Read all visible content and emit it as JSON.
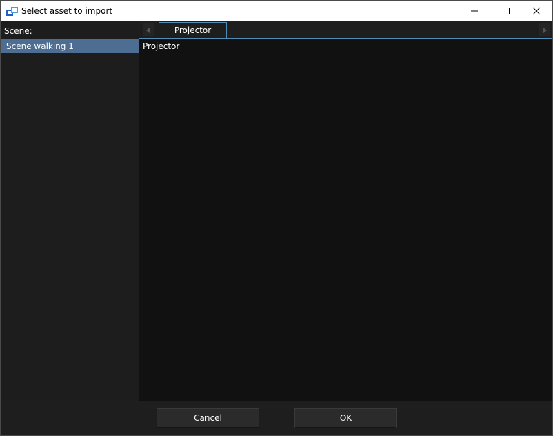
{
  "window": {
    "title": "Select asset to import"
  },
  "icons": {
    "app": "app-logo-icon",
    "minimize": "minimize-icon",
    "maximize": "maximize-icon",
    "close": "close-icon",
    "tab_scroll_left": "chevron-left-icon",
    "tab_scroll_right": "chevron-right-icon"
  },
  "sidebar": {
    "label": "Scene:",
    "items": [
      {
        "label": "Scene walking 1",
        "selected": true
      }
    ]
  },
  "tabs": [
    {
      "label": "Projector",
      "active": true
    }
  ],
  "content": {
    "items": [
      "Projector"
    ]
  },
  "footer": {
    "cancel_label": "Cancel",
    "ok_label": "OK"
  },
  "colors": {
    "selection": "#4e6d92",
    "accent": "#4f8db7",
    "background": "#1e1e1e",
    "content_background": "#111111"
  }
}
